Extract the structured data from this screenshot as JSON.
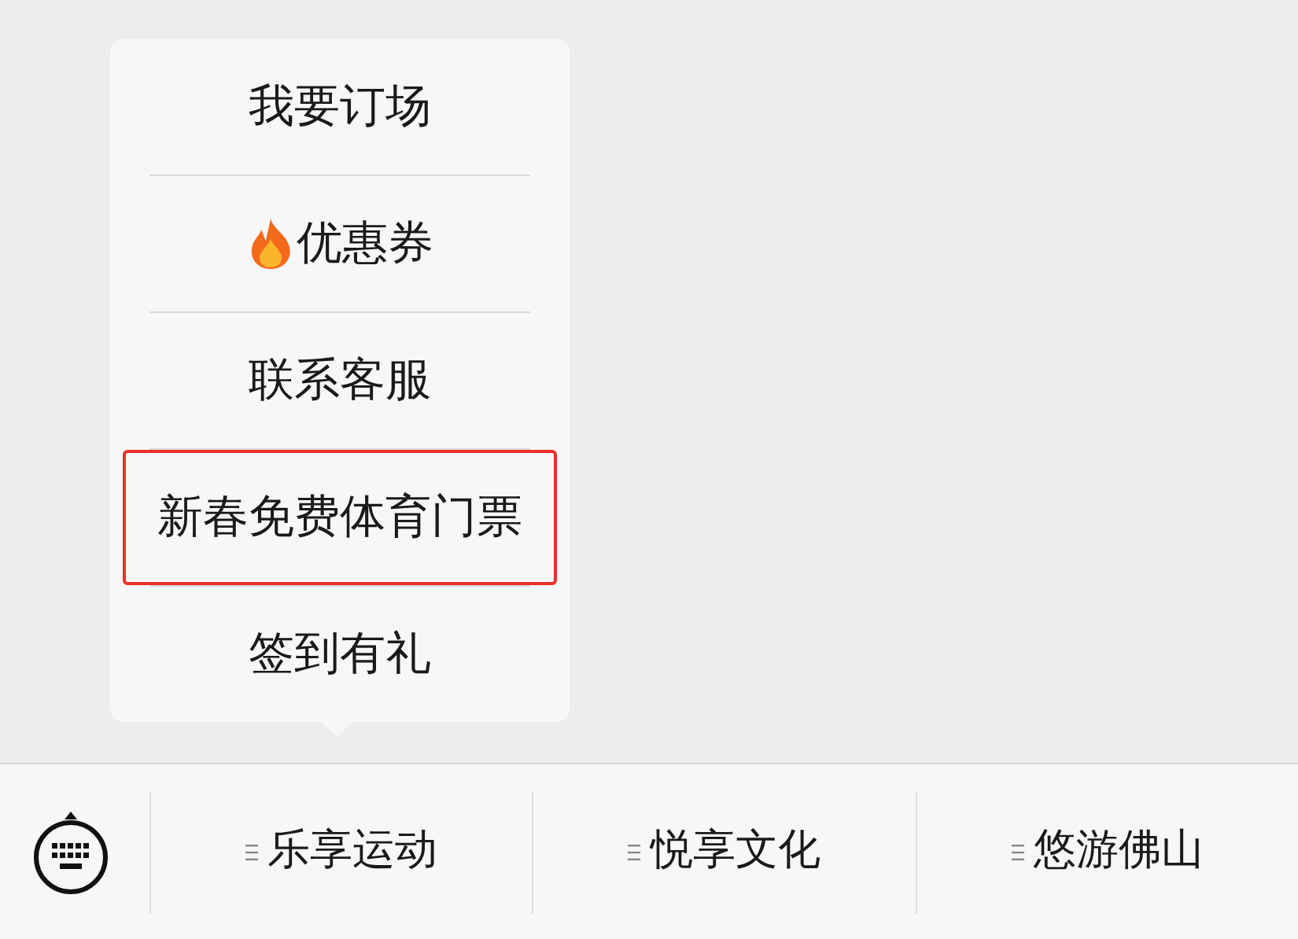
{
  "menu": {
    "items": [
      {
        "kind": "plain",
        "label": "我要订场",
        "highlighted": false
      },
      {
        "kind": "hot",
        "label": "优惠券",
        "highlighted": false
      },
      {
        "kind": "plain",
        "label": "联系客服",
        "highlighted": false
      },
      {
        "kind": "plain",
        "label": "新春免费体育门票",
        "highlighted": true
      },
      {
        "kind": "plain",
        "label": "签到有礼",
        "highlighted": false
      }
    ]
  },
  "bottom_bar": {
    "tabs": [
      {
        "label": "乐享运动"
      },
      {
        "label": "悦享文化"
      },
      {
        "label": "悠游佛山"
      }
    ]
  }
}
